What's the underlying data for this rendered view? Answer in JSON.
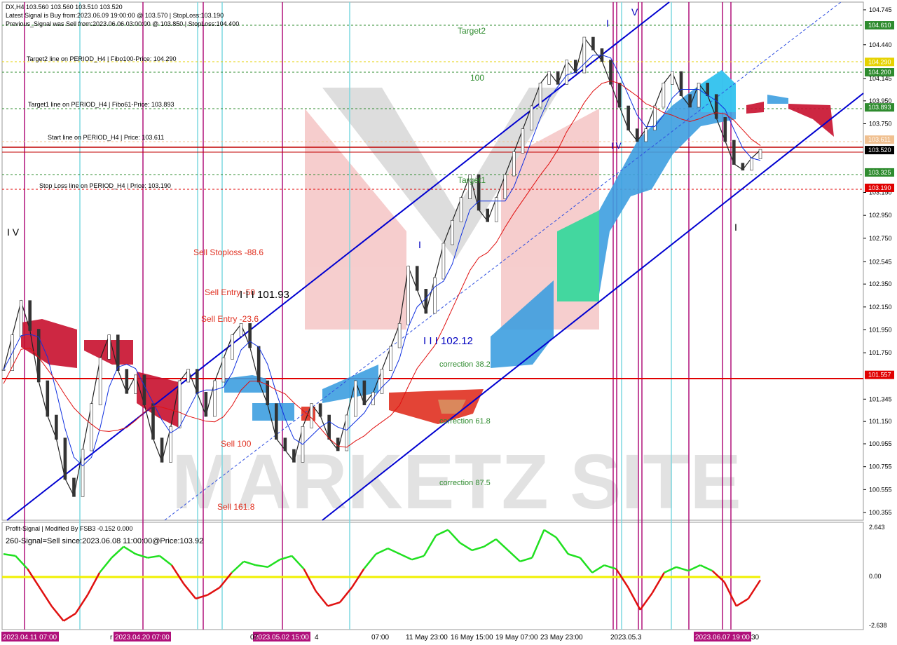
{
  "header": {
    "symbol_line": "DX,H4  103.560 103.560 103.510 103.520",
    "latest_signal": "Latest Signal is Buy from:2023.06.09 19:00:00 @ 103.570  | StopLoss:103.190",
    "previous_signal": "Previous_Signal was Sell from:2023.06.06 03:00:00 @ 103.850  | StopLoss:104.400"
  },
  "levels": {
    "target2": "Target2 line on PERIOD_H4 | Fibo100-Price: 104.290",
    "target1": "Target1 line on PERIOD_H4 | Fibo61-Price: 103.893",
    "start": "Start line on PERIOD_H4 | Price: 103.611",
    "stoploss": "Stop Loss line on PERIOD_H4 | Price: 103.190"
  },
  "annotations": {
    "target2": "Target2",
    "fibo100": "100",
    "target1": "Target1",
    "sell_stoploss": "Sell Stoploss -88.6",
    "sell_entry_50": "Sell Entry -50",
    "sell_entry_23": "Sell Entry -23.6",
    "sell_100": "Sell 100",
    "sell_161": "Sell 161.8",
    "corr_38": "correction 38.2",
    "corr_61": "correction 61.8",
    "corr_87": "correction 87.5",
    "price_101_93": "I I I 101.93",
    "price_102_12": "I I I 102.12",
    "roman_iv": "I V",
    "roman_i_a": "I",
    "roman_i_b": "I",
    "roman_i_c": "I",
    "roman_v": "V",
    "roman_iv_b": "I V"
  },
  "watermark": "MARKETZ SITE",
  "price_axis": {
    "ticks": [
      "104.745",
      "104.440",
      "104.145",
      "103.950",
      "103.750",
      "103.150",
      "102.950",
      "102.750",
      "102.545",
      "102.350",
      "102.150",
      "101.950",
      "101.750",
      "101.345",
      "101.150",
      "100.955",
      "100.755",
      "100.555",
      "100.355"
    ],
    "badges": [
      {
        "label": "104.610",
        "color": "#2e8b2e"
      },
      {
        "label": "104.290",
        "color": "#e6d200"
      },
      {
        "label": "104.200",
        "color": "#2e8b2e"
      },
      {
        "label": "103.893",
        "color": "#2e8b2e"
      },
      {
        "label": "103.611",
        "color": "#f0c090"
      },
      {
        "label": "103.520",
        "color": "#000000"
      },
      {
        "label": "103.325",
        "color": "#2e8b2e"
      },
      {
        "label": "103.190",
        "color": "#e00000"
      },
      {
        "label": "101.557",
        "color": "#e00000"
      }
    ]
  },
  "indicator": {
    "title": "Profit-Signal | Modified By FSB3 -0.152 0.000",
    "signal": "260-Signal=Sell since:2023.06.08 11:00:00@Price:103.92",
    "ticks": [
      "2.643",
      "0.00",
      "-2.638"
    ]
  },
  "time_axis": {
    "labels": [
      "2023.04.11 07:00",
      "2023.04.20 07:00",
      "2023.05.02 15:00",
      "11 May 23:00",
      "16 May 15:00",
      "19 May 07:00",
      "23 May 23:00",
      "2023.06.07 19:00"
    ],
    "fragments": [
      "r",
      "07",
      "4",
      "07:00",
      "2023.05.3",
      "30"
    ]
  },
  "chart_data": {
    "type": "line",
    "title": "DX,H4",
    "ylim": [
      100.3,
      104.8
    ],
    "series": [
      {
        "values": [
          101.6,
          101.9,
          102.2,
          101.95,
          101.5,
          101.2,
          101.0,
          100.65,
          100.5,
          100.9,
          101.3,
          101.7,
          101.9,
          101.6,
          101.4,
          101.55,
          101.3,
          101.0,
          100.8,
          101.1,
          101.5,
          101.6,
          101.4,
          101.2,
          101.5,
          101.7,
          101.9,
          102.0,
          101.8,
          101.5,
          101.3,
          101.0,
          100.9,
          100.8,
          101.1,
          101.3,
          101.2,
          101.0,
          100.9,
          101.2,
          101.5,
          101.3,
          101.4,
          101.6,
          101.8,
          102.0,
          102.5,
          102.3,
          102.1,
          102.4,
          102.7,
          102.9,
          103.1,
          103.3,
          103.0,
          102.9,
          103.1,
          103.3,
          103.5,
          103.7,
          103.9,
          104.1,
          104.2,
          104.1,
          104.3,
          104.2,
          104.5,
          104.4,
          104.3,
          104.1,
          103.9,
          103.7,
          103.6,
          103.7,
          103.9,
          104.1,
          104.2,
          104.0,
          103.9,
          104.1,
          104.0,
          103.8,
          103.6,
          103.4,
          103.35,
          103.45,
          103.52
        ]
      }
    ],
    "h_lines": [
      104.61,
      104.29,
      104.2,
      103.893,
      103.611,
      103.52,
      103.325,
      103.19,
      101.557
    ],
    "indicator_series": [
      {
        "values": [
          1.2,
          1.1,
          0.4,
          -0.6,
          -1.6,
          -2.4,
          -2.0,
          -1.0,
          0.2,
          1.0,
          1.6,
          1.2,
          1.0,
          1.1,
          0.6,
          -0.4,
          -1.2,
          -1.0,
          -0.6,
          0.2,
          0.8,
          0.6,
          0.5,
          0.9,
          1.1,
          0.4,
          -0.8,
          -1.6,
          -1.4,
          -0.6,
          0.4,
          1.2,
          1.5,
          1.2,
          0.9,
          1.1,
          2.2,
          2.5,
          1.8,
          1.4,
          1.6,
          2.0,
          1.4,
          0.8,
          1.0,
          2.5,
          2.1,
          1.2,
          1.0,
          0.2,
          0.6,
          0.4,
          -0.6,
          -1.8,
          -0.9,
          0.2,
          0.5,
          0.3,
          0.6,
          0.3,
          -0.3,
          -1.6,
          -1.2,
          -0.2
        ]
      }
    ]
  }
}
